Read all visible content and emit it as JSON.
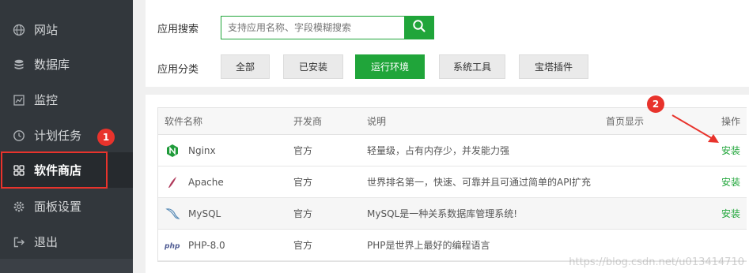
{
  "sidebar": {
    "items": [
      {
        "label": "网站",
        "icon": "globe-icon"
      },
      {
        "label": "数据库",
        "icon": "database-icon"
      },
      {
        "label": "监控",
        "icon": "monitor-icon"
      },
      {
        "label": "计划任务",
        "icon": "clock-icon"
      },
      {
        "label": "软件商店",
        "icon": "grid-icon"
      },
      {
        "label": "面板设置",
        "icon": "gear-icon"
      },
      {
        "label": "退出",
        "icon": "logout-icon"
      }
    ],
    "active_index": 4
  },
  "annotations": {
    "badge1": "1",
    "badge2": "2",
    "highlight_color": "#e8332c"
  },
  "search": {
    "label": "应用搜索",
    "placeholder": "支持应用名称、字段模糊搜索"
  },
  "categories": {
    "label": "应用分类",
    "items": [
      "全部",
      "已安装",
      "运行环境",
      "系统工具",
      "宝塔插件"
    ],
    "active_index": 2
  },
  "table": {
    "headers": {
      "name": "软件名称",
      "developer": "开发商",
      "desc": "说明",
      "home": "首页显示",
      "op": "操作"
    },
    "rows": [
      {
        "name": "Nginx",
        "icon": "nginx-icon",
        "developer": "官方",
        "desc": "轻量级，占有内存少，并发能力强",
        "op": "安装"
      },
      {
        "name": "Apache",
        "icon": "apache-feather-icon",
        "developer": "官方",
        "desc": "世界排名第一，快速、可靠并且可通过简单的API扩充",
        "op": "安装"
      },
      {
        "name": "MySQL",
        "icon": "mysql-dolphin-icon",
        "developer": "官方",
        "desc": "MySQL是一种关系数据库管理系统!",
        "op": "安装"
      },
      {
        "name": "PHP-8.0",
        "icon": "php-icon",
        "developer": "官方",
        "desc": "PHP是世界上最好的编程语言",
        "op": ""
      }
    ]
  },
  "watermark": "https://blog.csdn.net/u013414710",
  "colors": {
    "brand": "#20a53a",
    "sidebar_bg": "#32373c",
    "sidebar_active": "#262a2e"
  }
}
